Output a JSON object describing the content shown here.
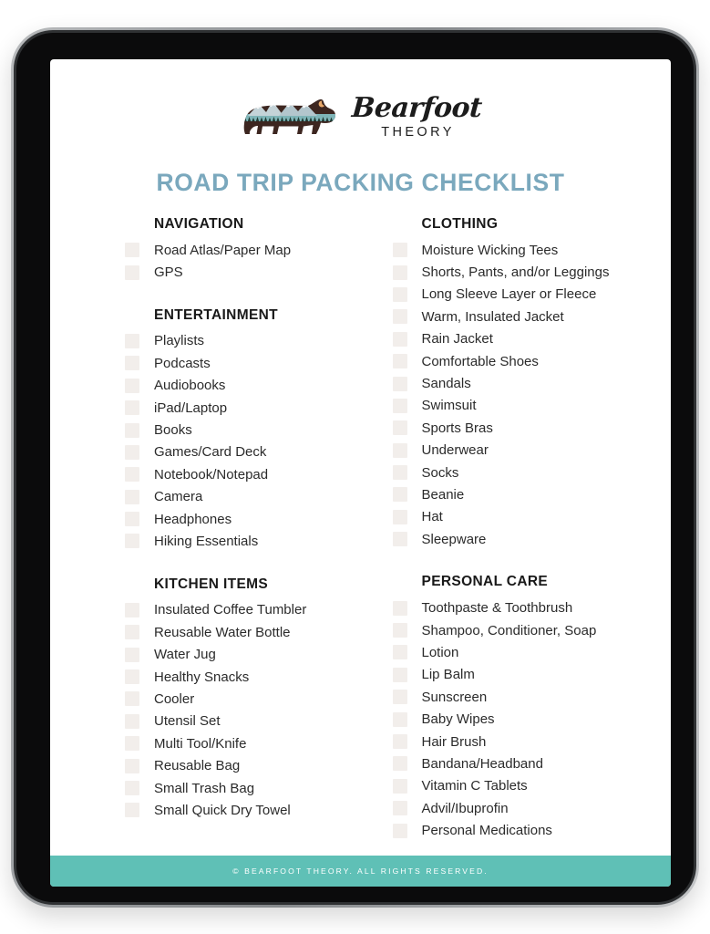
{
  "device": {
    "type": "tablet-mockup"
  },
  "header": {
    "logo_icon": "bear-mountain-logo",
    "brand_name": "Bearfoot",
    "brand_subtitle": "THEORY"
  },
  "title": "ROAD TRIP PACKING CHECKLIST",
  "colors": {
    "title": "#7aa8bd",
    "footer_bar": "#5fc0b6",
    "checkbox": "#f2eeeb",
    "text": "#2b2b2b",
    "bear_body": "#3d2620",
    "bear_water": "#7fb5b8",
    "bear_trees": "#1f3b34",
    "bezel": "#0b0b0c",
    "device_edge": "#9a9da0"
  },
  "columns": {
    "left": [
      {
        "heading": "NAVIGATION",
        "items": [
          "Road Atlas/Paper Map",
          "GPS"
        ]
      },
      {
        "heading": "ENTERTAINMENT",
        "items": [
          "Playlists",
          "Podcasts",
          "Audiobooks",
          "iPad/Laptop",
          "Books",
          "Games/Card Deck",
          "Notebook/Notepad",
          "Camera",
          "Headphones",
          "Hiking Essentials"
        ]
      },
      {
        "heading": "KITCHEN ITEMS",
        "items": [
          "Insulated Coffee Tumbler",
          "Reusable Water Bottle",
          "Water Jug",
          "Healthy Snacks",
          "Cooler",
          "Utensil Set",
          "Multi Tool/Knife",
          "Reusable Bag",
          "Small Trash Bag",
          "Small Quick Dry Towel"
        ]
      }
    ],
    "right": [
      {
        "heading": "CLOTHING",
        "items": [
          "Moisture Wicking Tees",
          "Shorts, Pants, and/or Leggings",
          "Long Sleeve Layer or Fleece",
          "Warm, Insulated Jacket",
          "Rain Jacket",
          "Comfortable Shoes",
          "Sandals",
          "Swimsuit",
          "Sports Bras",
          "Underwear",
          "Socks",
          "Beanie",
          "Hat",
          "Sleepware"
        ]
      },
      {
        "heading": "PERSONAL CARE",
        "items": [
          "Toothpaste & Toothbrush",
          "Shampoo, Conditioner, Soap",
          "Lotion",
          "Lip Balm",
          "Sunscreen",
          "Baby Wipes",
          "Hair Brush",
          "Bandana/Headband",
          "Vitamin C Tablets",
          "Advil/Ibuprofin",
          "Personal Medications"
        ]
      }
    ]
  },
  "footer": {
    "copyright": "© BEARFOOT THEORY. ALL RIGHTS RESERVED."
  }
}
